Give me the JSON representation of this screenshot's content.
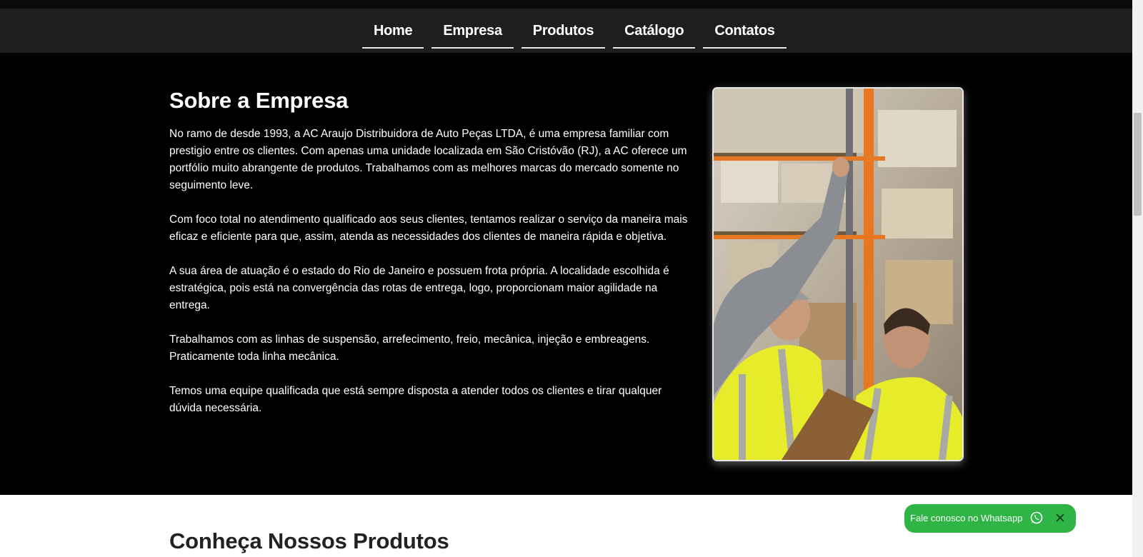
{
  "nav": {
    "items": [
      {
        "label": "Home"
      },
      {
        "label": "Empresa"
      },
      {
        "label": "Produtos"
      },
      {
        "label": "Catálogo"
      },
      {
        "label": "Contatos"
      }
    ]
  },
  "about": {
    "title": "Sobre a Empresa",
    "paragraphs": [
      "No ramo de desde 1993, a AC Araujo Distribuidora de Auto Peças LTDA, é uma empresa familiar com prestigio entre os clientes. Com apenas uma unidade localizada em São Cristóvão (RJ), a AC oferece um portfólio muito abrangente de produtos. Trabalhamos com as melhores marcas do mercado somente no seguimento leve.",
      "Com foco total no atendimento qualificado aos seus clientes, tentamos realizar o serviço da maneira mais eficaz e eficiente para que, assim, atenda as necessidades dos clientes de maneira rápida e objetiva.",
      "A sua área de atuação é o estado do Rio de Janeiro e possuem frota própria. A localidade escolhida é estratégica, pois está na convergência das rotas de entrega, logo, proporcionam maior agilidade na entrega.",
      "Trabalhamos com as linhas de suspensão, arrefecimento, freio, mecânica, injeção e embreagens. Praticamente toda linha mecânica.",
      "Temos uma equipe qualificada que está sempre disposta a atender todos os clientes e tirar qualquer dúvida necessária."
    ]
  },
  "products": {
    "title": "Conheça Nossos Produtos"
  },
  "whatsapp": {
    "label": "Fale conosco no Whatsapp",
    "icon": "whatsapp-icon",
    "close_icon": "close-icon"
  },
  "colors": {
    "navbar": "#1e1e1e",
    "about_background": "#000000",
    "whatsapp_green": "#2fb545",
    "vest_yellow": "#e6ec2a",
    "rack_orange": "#e87722"
  }
}
